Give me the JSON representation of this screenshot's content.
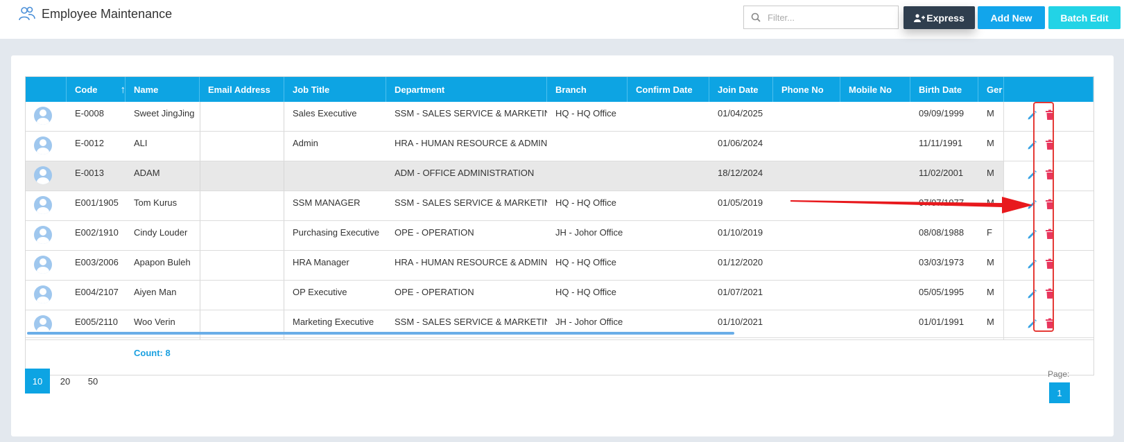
{
  "header": {
    "title": "Employee Maintenance",
    "filter_placeholder": "Filter...",
    "express_label": "Express",
    "add_new_label": "Add New",
    "batch_edit_label": "Batch Edit"
  },
  "grid": {
    "columns": [
      "",
      "Code",
      "Name",
      "Email Address",
      "Job Title",
      "Department",
      "Branch",
      "Confirm Date",
      "Join Date",
      "Phone No",
      "Mobile No",
      "Birth Date",
      "Ger"
    ],
    "sort_indicator": "↑",
    "rows": [
      {
        "code": "E-0008",
        "name": "Sweet JingJing",
        "email": "",
        "job": "Sales Executive",
        "dept": "SSM - SALES SERVICE & MARKETING",
        "branch": "HQ - HQ Office",
        "confirm": "",
        "join": "01/04/2025",
        "phone": "",
        "mobile": "",
        "birth": "09/09/1999",
        "gender": "M"
      },
      {
        "code": "E-0012",
        "name": "ALI",
        "email": "",
        "job": "Admin",
        "dept": "HRA - HUMAN RESOURCE & ADMIN",
        "branch": "",
        "confirm": "",
        "join": "01/06/2024",
        "phone": "",
        "mobile": "",
        "birth": "11/11/1991",
        "gender": "M"
      },
      {
        "code": "E-0013",
        "name": "ADAM",
        "email": "",
        "job": "",
        "dept": "ADM - OFFICE ADMINISTRATION",
        "branch": "",
        "confirm": "",
        "join": "18/12/2024",
        "phone": "",
        "mobile": "",
        "birth": "11/02/2001",
        "gender": "M"
      },
      {
        "code": "E001/1905",
        "name": "Tom Kurus",
        "email": "",
        "job": "SSM MANAGER",
        "dept": "SSM - SALES SERVICE & MARKETING",
        "branch": "HQ - HQ Office",
        "confirm": "",
        "join": "01/05/2019",
        "phone": "",
        "mobile": "",
        "birth": "07/07/1977",
        "gender": "M"
      },
      {
        "code": "E002/1910",
        "name": "Cindy Louder",
        "email": "",
        "job": "Purchasing Executive",
        "dept": "OPE - OPERATION",
        "branch": "JH - Johor Office",
        "confirm": "",
        "join": "01/10/2019",
        "phone": "",
        "mobile": "",
        "birth": "08/08/1988",
        "gender": "F"
      },
      {
        "code": "E003/2006",
        "name": "Apapon Buleh",
        "email": "",
        "job": "HRA Manager",
        "dept": "HRA - HUMAN RESOURCE & ADMIN",
        "branch": "HQ - HQ Office",
        "confirm": "",
        "join": "01/12/2020",
        "phone": "",
        "mobile": "",
        "birth": "03/03/1973",
        "gender": "M"
      },
      {
        "code": "E004/2107",
        "name": "Aiyen Man",
        "email": "",
        "job": "OP Executive",
        "dept": "OPE - OPERATION",
        "branch": "HQ - HQ Office",
        "confirm": "",
        "join": "01/07/2021",
        "phone": "",
        "mobile": "",
        "birth": "05/05/1995",
        "gender": "M"
      },
      {
        "code": "E005/2110",
        "name": "Woo Verin",
        "email": "",
        "job": "Marketing Executive",
        "dept": "SSM - SALES SERVICE & MARKETING",
        "branch": "JH - Johor Office",
        "confirm": "",
        "join": "01/10/2021",
        "phone": "",
        "mobile": "",
        "birth": "01/01/1991",
        "gender": "M"
      }
    ],
    "selected_row": 2,
    "count_label": "Count: 8"
  },
  "pager": {
    "sizes": [
      "10",
      "20",
      "50"
    ],
    "active_size": "10",
    "page_label": "Page:",
    "current_page": "1"
  },
  "colors": {
    "header_bg": "#0da4e3",
    "express_bg": "#2f3e4e",
    "add_bg": "#12a5eb",
    "batch_bg": "#22d3e6",
    "edit_icon": "#3aa3e3",
    "delete_icon": "#e8365d",
    "annotation": "#e53935"
  }
}
